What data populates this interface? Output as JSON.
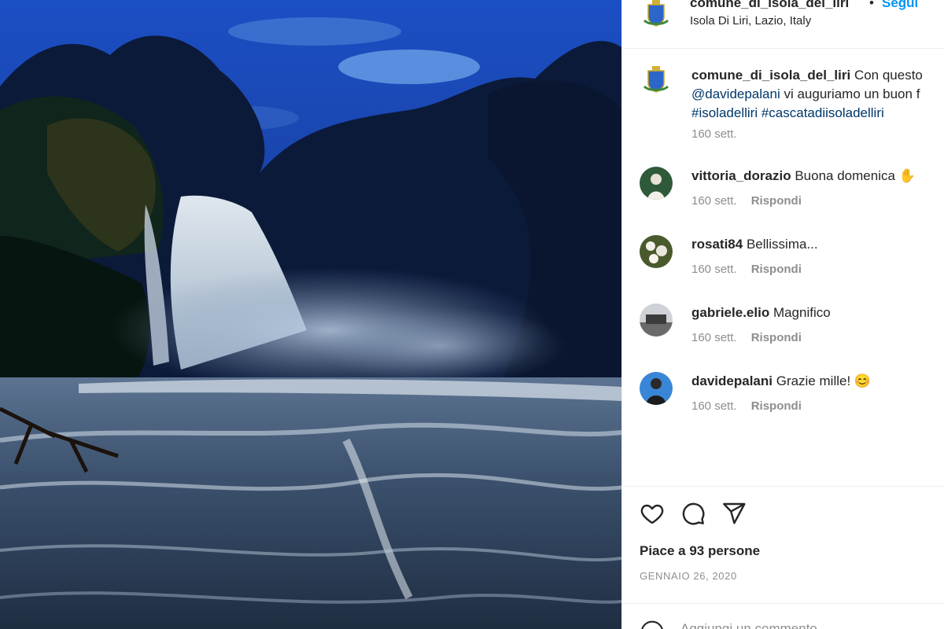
{
  "post": {
    "username": "comune_di_isola_del_liri",
    "separator": "•",
    "follow_label": "Segui",
    "location": "Isola Di Liri, Lazio, Italy"
  },
  "caption": {
    "username": "comune_di_isola_del_liri",
    "line1_rest": "Con questo",
    "mention": "@davidepalani",
    "line2_rest": "vi auguriamo un buon f",
    "hashtags": [
      "#isoladelliri",
      "#cascatadiisoladelliri"
    ],
    "time": "160 sett."
  },
  "comments": [
    {
      "username": "vittoria_dorazio",
      "text": "Buona domenica",
      "emoji": "✋",
      "time": "160 sett.",
      "reply": "Rispondi"
    },
    {
      "username": "rosati84",
      "text": "Bellissima...",
      "emoji": "",
      "time": "160 sett.",
      "reply": "Rispondi"
    },
    {
      "username": "gabriele.elio",
      "text": "Magnifico",
      "emoji": "",
      "time": "160 sett.",
      "reply": "Rispondi"
    },
    {
      "username": "davidepalani",
      "text": "Grazie mille!",
      "emoji": "😊",
      "time": "160 sett.",
      "reply": "Rispondi"
    }
  ],
  "actions": {
    "likes": "Piace a 93 persone",
    "date": "GENNAIO 26, 2020",
    "add_comment_placeholder": "Aggiungi un commento..."
  },
  "icons": {
    "like": "heart-icon",
    "comment": "comment-icon",
    "share": "paper-plane-icon",
    "emoji": "smiley-icon"
  },
  "colors": {
    "link": "#00376b",
    "follow": "#0095f6",
    "muted": "#8e8e8e"
  }
}
